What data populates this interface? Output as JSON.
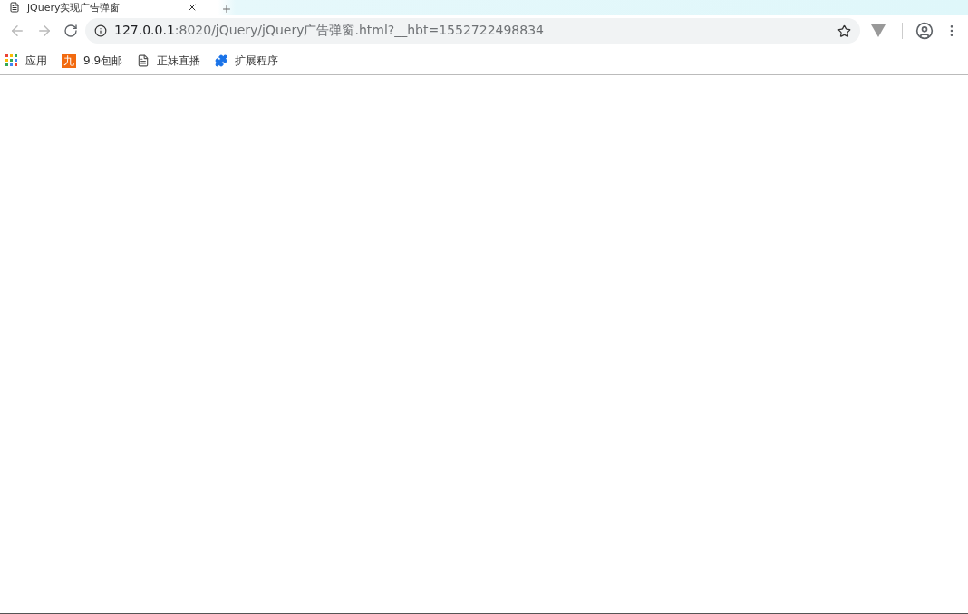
{
  "tab": {
    "title": "jQuery实现广告弹窗",
    "selected": true
  },
  "address_bar": {
    "host": "127.0.0.1",
    "path": ":8020/jQuery/jQuery广告弹窗.html?__hbt=1552722498834"
  },
  "bookmarks": [
    {
      "kind": "apps",
      "label": "应用"
    },
    {
      "kind": "badge",
      "badge": "九",
      "label": "9.9包邮"
    },
    {
      "kind": "page",
      "label": "正妹直播"
    },
    {
      "kind": "extension",
      "label": "扩展程序"
    }
  ]
}
